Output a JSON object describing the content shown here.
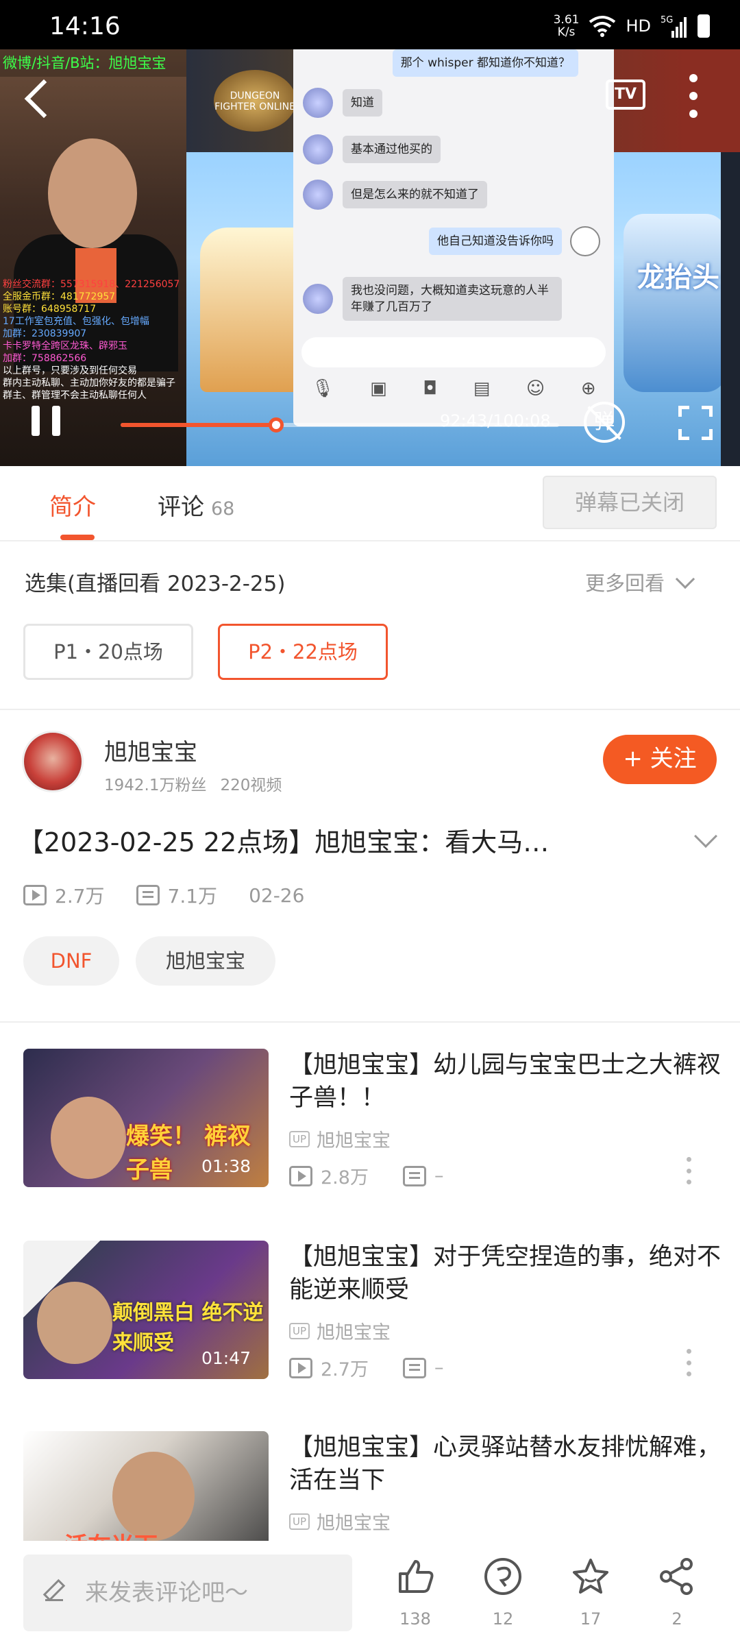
{
  "status_bar": {
    "time": "14:16",
    "net_speed": "3.61\nK/s",
    "hd": "HD",
    "signal": "5G"
  },
  "player": {
    "overlay_banner": "微博/抖音/B站：旭旭宝宝",
    "overlay_lines": [
      {
        "text": "粉丝交流群：557315918、221256057",
        "color": "r"
      },
      {
        "text": "全服金币群：481772957",
        "color": "y"
      },
      {
        "text": "账号群：648958717",
        "color": "y"
      },
      {
        "text": "17工作室包充值、包强化、包增幅",
        "color": "c"
      },
      {
        "text": "加群：230839907",
        "color": "c"
      },
      {
        "text": "卡卡罗特全跨区龙珠、辟邪玉",
        "color": "m"
      },
      {
        "text": "加群：758862566",
        "color": "m"
      },
      {
        "text": "以上群号，只要涉及到任何交易",
        "color": "w"
      },
      {
        "text": "群内主动私聊、主动加你好友的都是骗子",
        "color": "w"
      },
      {
        "text": "群主、群管理不会主动私聊任何人",
        "color": "w"
      }
    ],
    "game_logo": "DUNGEON FIGHTER ONLINE",
    "game_side_text": "龙抬头",
    "chat": [
      {
        "text": "那个 whisper 都知道你不知道？",
        "me": true
      },
      {
        "text": "知道",
        "me": false
      },
      {
        "text": "基本通过他买的",
        "me": false
      },
      {
        "text": "但是怎么来的就不知道了",
        "me": false
      },
      {
        "text": "他自己知道没告诉你吗",
        "me": true
      },
      {
        "text": "我也没问题，大概知道卖这玩意的人半年赚了几百万了",
        "me": false
      }
    ],
    "tv_label": "TV",
    "time": "92:43/100:08",
    "progress": 0.355,
    "danmu_label": "弹"
  },
  "tabs": {
    "intro": "简介",
    "comments": "评论",
    "comments_count": "68",
    "danmu_closed": "弹幕已关闭"
  },
  "episodes": {
    "label": "选集(直播回看 2023-2-25)",
    "more": "更多回看",
    "items": [
      "P1・20点场",
      "P2・22点场"
    ],
    "active_index": 1
  },
  "uploader": {
    "name": "旭旭宝宝",
    "fans": "1942.1万粉丝",
    "videos": "220视频",
    "follow": "+ 关注"
  },
  "video": {
    "title": "【2023-02-25 22点场】旭旭宝宝：看大马…",
    "plays": "2.7万",
    "danmaku": "7.1万",
    "date": "02-26",
    "tags": [
      "DNF",
      "旭旭宝宝"
    ]
  },
  "related": [
    {
      "title": "【旭旭宝宝】幼儿园与宝宝巴士之大裤衩子兽！！",
      "up": "旭旭宝宝",
      "plays": "2.8万",
      "danmaku": "–",
      "duration": "01:38",
      "thumb_text": "爆笑！ 裤衩子兽"
    },
    {
      "title": "【旭旭宝宝】对于凭空捏造的事，绝对不能逆来顺受",
      "up": "旭旭宝宝",
      "plays": "2.7万",
      "danmaku": "–",
      "duration": "01:47",
      "thumb_text": "颠倒黑白 绝不逆来顺受"
    },
    {
      "title": "【旭旭宝宝】心灵驿站替水友排忧解难，活在当下",
      "up": "旭旭宝宝",
      "plays": "",
      "danmaku": "",
      "duration": "",
      "thumb_text": "活在当下"
    }
  ],
  "up_badge": "UP",
  "bottom": {
    "placeholder": "来发表评论吧～",
    "likes": "138",
    "coins": "12",
    "favorites": "17",
    "shares": "2"
  },
  "colors": {
    "accent": "#f2552e",
    "follow": "#f45a23"
  }
}
